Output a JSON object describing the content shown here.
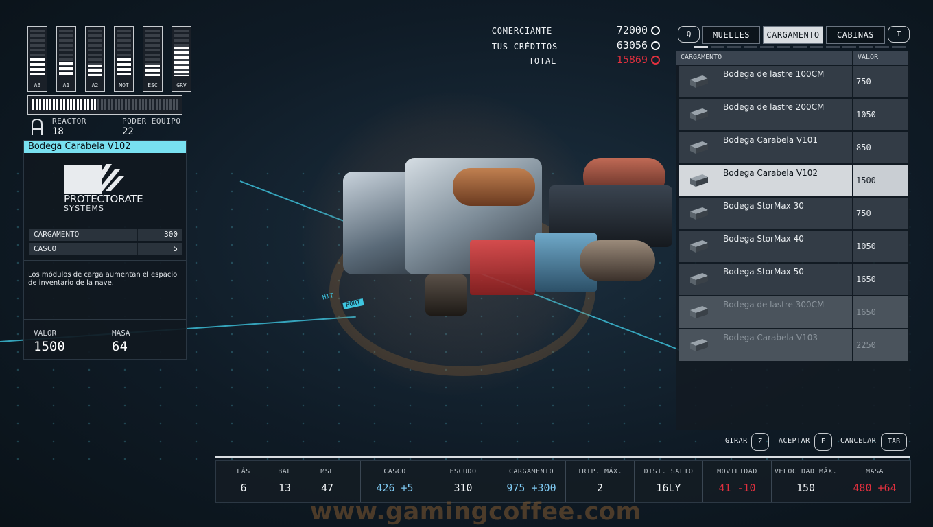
{
  "ship_systems": {
    "gauges": [
      {
        "label": "AB",
        "level": 0.4
      },
      {
        "label": "A1",
        "level": 0.3
      },
      {
        "label": "A2",
        "level": 0.25
      },
      {
        "label": "MOT",
        "level": 0.4
      },
      {
        "label": "ESC",
        "level": 0.25
      },
      {
        "label": "GRV",
        "level": 0.65
      }
    ],
    "power_level": 0.45,
    "reactor_label": "REACTOR",
    "reactor_value": "18",
    "equip_power_label": "PODER EQUIPO",
    "equip_power_value": "22"
  },
  "item": {
    "title": "Bodega Carabela V102",
    "brand_name": "PROTECTORATE",
    "brand_sub": "SYSTEMS",
    "stats": [
      {
        "label": "CARGAMENTO",
        "value": "300"
      },
      {
        "label": "CASCO",
        "value": "5"
      }
    ],
    "description": "Los módulos de carga aumentan el espacio de inventario de la nave.",
    "value_label": "VALOR",
    "value": "1500",
    "mass_label": "MASA",
    "mass": "64"
  },
  "trade": {
    "merchant_label": "COMERCIANTE",
    "merchant_value": "72000",
    "credits_label": "TUS CRÉDITOS",
    "credits_value": "63056",
    "total_label": "TOTAL",
    "total_value": "15869",
    "total_color": "#e0303e"
  },
  "tabs": {
    "prev_key": "Q",
    "next_key": "T",
    "items": [
      {
        "label": "MUELLES",
        "active": false
      },
      {
        "label": "CARGAMENTO",
        "active": true
      },
      {
        "label": "CABINAS",
        "active": false
      }
    ]
  },
  "list": {
    "col_name": "CARGAMENTO",
    "col_value": "VALOR",
    "rows": [
      {
        "name": "Bodega de lastre 100CM",
        "value": "750",
        "state": "normal"
      },
      {
        "name": "Bodega de lastre 200CM",
        "value": "1050",
        "state": "normal"
      },
      {
        "name": "Bodega Carabela V101",
        "value": "850",
        "state": "normal"
      },
      {
        "name": "Bodega Carabela V102",
        "value": "1500",
        "state": "selected"
      },
      {
        "name": "Bodega StorMax 30",
        "value": "750",
        "state": "normal"
      },
      {
        "name": "Bodega StorMax 40",
        "value": "1050",
        "state": "normal"
      },
      {
        "name": "Bodega StorMax 50",
        "value": "1650",
        "state": "normal"
      },
      {
        "name": "Bodega de lastre 300CM",
        "value": "1650",
        "state": "disabled"
      },
      {
        "name": "Bodega Carabela V103",
        "value": "2250",
        "state": "disabled"
      }
    ]
  },
  "controls": [
    {
      "label": "GIRAR",
      "key": "Z"
    },
    {
      "label": "ACEPTAR",
      "key": "E"
    },
    {
      "label": "CANCELAR",
      "key": "TAB"
    }
  ],
  "bottom_stats": {
    "weapons": [
      {
        "label": "LÁS",
        "value": "6"
      },
      {
        "label": "BAL",
        "value": "13"
      },
      {
        "label": "MSL",
        "value": "47"
      }
    ],
    "hull": {
      "label": "CASCO",
      "value": "426 +5"
    },
    "shield": {
      "label": "ESCUDO",
      "value": "310"
    },
    "cargo": {
      "label": "CARGAMENTO",
      "value": "975 +300"
    },
    "crew": {
      "label": "TRIP. MÁX.",
      "value": "2"
    },
    "jump": {
      "label": "DIST. SALTO",
      "value": "16LY"
    },
    "mobility": {
      "label": "MOVILIDAD",
      "value": "41 -10"
    },
    "speed": {
      "label": "VELOCIDAD MÁX.",
      "value": "150"
    },
    "mass": {
      "label": "MASA",
      "value": "480 +64"
    },
    "positive_color": "#7ec8f0",
    "negative_color": "#e0303e"
  },
  "viewport": {
    "tag_port": "PORT",
    "tag_hit": "HIT"
  },
  "watermark": "www.gamingcoffee.com"
}
